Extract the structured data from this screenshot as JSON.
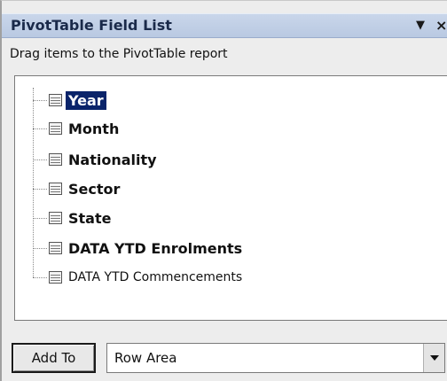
{
  "pane": {
    "title": "PivotTable Field List",
    "dropdown_glyph": "▼",
    "close_glyph": "×",
    "instruction": "Drag items to the PivotTable report"
  },
  "fields": [
    {
      "label": "Year",
      "bold": true,
      "selected": true,
      "icon": "field-icon"
    },
    {
      "label": "Month",
      "bold": true,
      "selected": false,
      "icon": "field-icon"
    },
    {
      "label": "Nationality",
      "bold": true,
      "selected": false,
      "icon": "field-icon"
    },
    {
      "label": "Sector",
      "bold": true,
      "selected": false,
      "icon": "field-icon"
    },
    {
      "label": "State",
      "bold": true,
      "selected": false,
      "icon": "field-icon"
    },
    {
      "label": "DATA YTD Enrolments",
      "bold": true,
      "selected": false,
      "icon": "field-icon"
    },
    {
      "label": "DATA YTD Commencements",
      "bold": false,
      "selected": false,
      "icon": "field-icon"
    }
  ],
  "bottom": {
    "add_to_label": "Add To",
    "area_value": "Row Area"
  },
  "colors": {
    "title_bar": "#c9d6ea",
    "selection": "#0a246a"
  }
}
